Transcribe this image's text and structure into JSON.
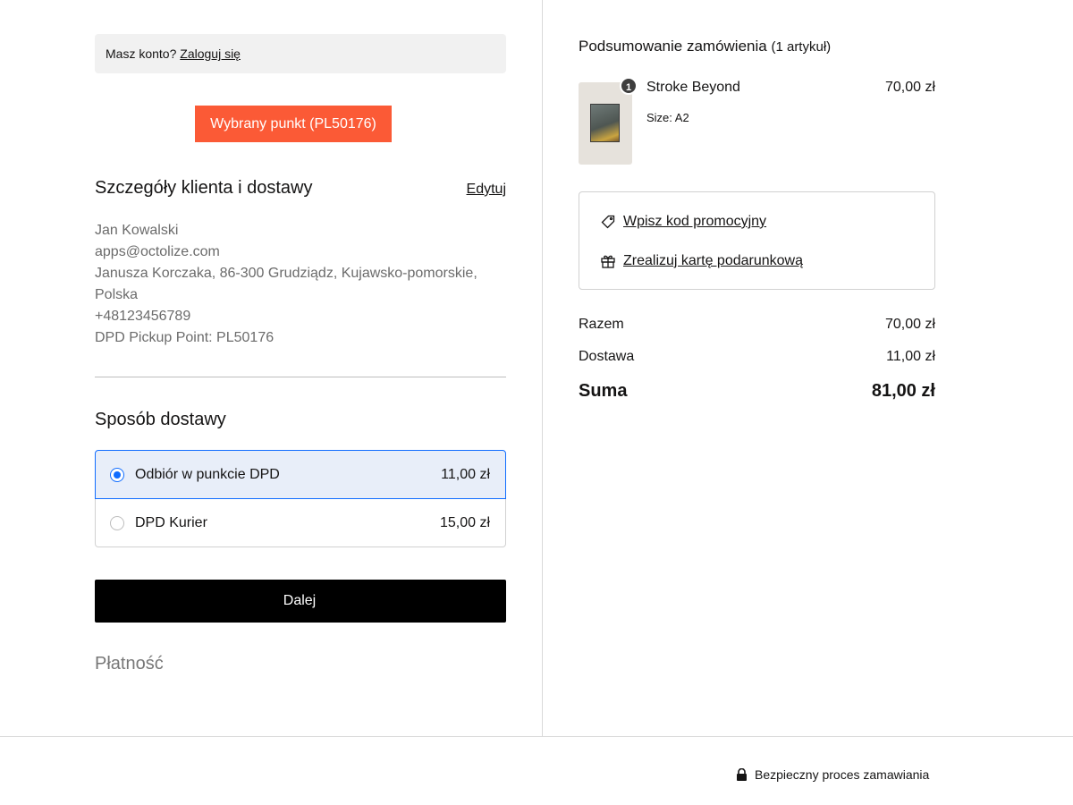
{
  "login": {
    "prompt": "Masz konto?",
    "link": "Zaloguj się"
  },
  "pickup_button": "Wybrany punkt (PL50176)",
  "customer": {
    "title": "Szczegóły klienta i dostawy",
    "edit": "Edytuj",
    "name": "Jan Kowalski",
    "email": "apps@octolize.com",
    "address": "Janusza Korczaka, 86-300 Grudziądz, Kujawsko-pomorskie, Polska",
    "phone": "+48123456789",
    "pickup_point": "DPD Pickup Point: PL50176"
  },
  "shipping": {
    "title": "Sposób dostawy",
    "options": [
      {
        "label": "Odbiór w punkcie DPD",
        "price": "11,00 zł",
        "selected": true
      },
      {
        "label": "DPD Kurier",
        "price": "15,00 zł",
        "selected": false
      }
    ]
  },
  "next_button": "Dalej",
  "payment_title": "Płatność",
  "summary": {
    "title": "Podsumowanie zamówienia",
    "count": "(1 artykuł)",
    "item": {
      "quantity": "1",
      "name": "Stroke Beyond",
      "size": "Size: A2",
      "price": "70,00 zł"
    },
    "promo_code": "Wpisz kod promocyjny",
    "gift_card": "Zrealizuj kartę podarunkową",
    "subtotal_label": "Razem",
    "subtotal_value": "70,00 zł",
    "shipping_label": "Dostawa",
    "shipping_value": "11,00 zł",
    "total_label": "Suma",
    "total_value": "81,00 zł"
  },
  "footer": {
    "secure_text": "Bezpieczny proces zamawiania"
  },
  "colors": {
    "accent": "#fb5a36",
    "selected_bg": "#e8eef9",
    "selected_border": "#116dff",
    "primary_button": "#000000"
  }
}
